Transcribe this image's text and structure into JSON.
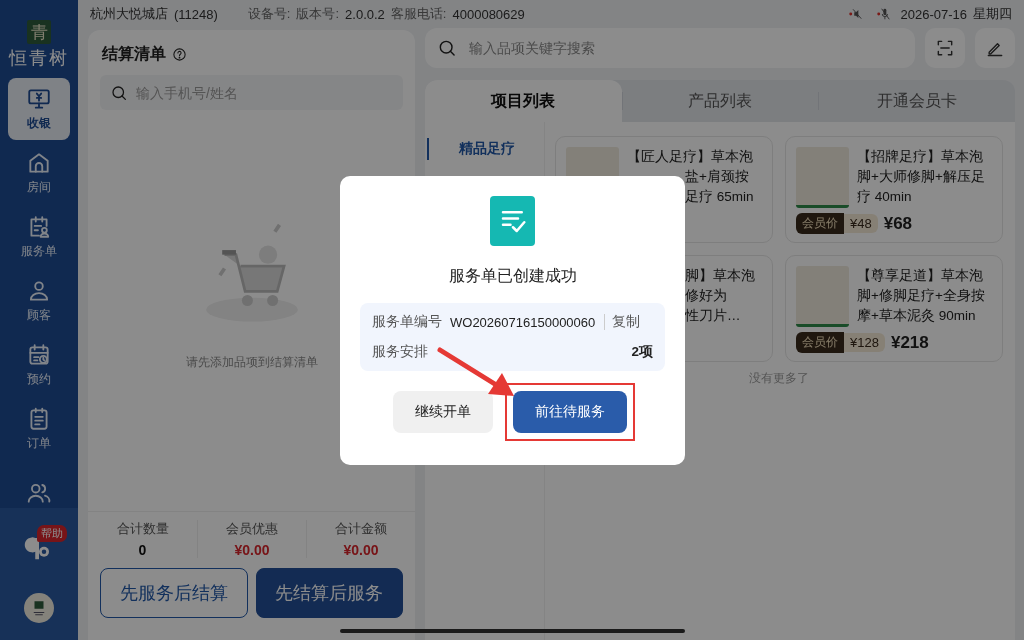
{
  "status_bar": {
    "store": "杭州大悦城店",
    "store_code": "(11248)",
    "device_label": "设备号:",
    "version_label": "版本号:",
    "version": "2.0.0.2",
    "hotline_label": "客服电话:",
    "hotline": "4000080629",
    "date": "2026-07-16",
    "weekday": "星期四"
  },
  "sidebar": {
    "logo_char": "青",
    "brand": "恒青树",
    "items": [
      {
        "label": "收银",
        "selected": true
      },
      {
        "label": "房间",
        "selected": false
      },
      {
        "label": "服务单",
        "selected": false
      },
      {
        "label": "顾客",
        "selected": false
      },
      {
        "label": "预约",
        "selected": false
      },
      {
        "label": "订单",
        "selected": false
      },
      {
        "selected": false
      }
    ],
    "help_badge": "帮助"
  },
  "checkout": {
    "title": "结算清单",
    "search": {
      "placeholder": "输入手机号/姓名"
    },
    "empty_text": "请先添加品项到结算清单",
    "totals": [
      {
        "label": "合计数量",
        "value": "0",
        "kind": "count"
      },
      {
        "label": "会员优惠",
        "value": "¥0.00",
        "kind": "money"
      },
      {
        "label": "合计金额",
        "value": "¥0.00",
        "kind": "money"
      }
    ],
    "buttons": [
      {
        "label": "先服务后结算",
        "kind": "secondary"
      },
      {
        "label": "先结算后服务",
        "kind": "primary"
      }
    ]
  },
  "catalog": {
    "search": {
      "placeholder": "输入品项关键字搜索"
    },
    "tabs": [
      {
        "label": "项目列表",
        "selected": true
      },
      {
        "label": "产品列表",
        "selected": false
      },
      {
        "label": "开通会员卡",
        "selected": false
      }
    ],
    "categories": [
      {
        "label": "精品足疗",
        "selected": true
      }
    ],
    "cards": [
      {
        "kind": "covered",
        "lines": [
          {
            "text": "【匠人足疗】草本泡",
            "clipped": false
          },
          {
            "text": "盐+肩颈按",
            "clipped": true
          },
          {
            "text": "足疗 65min",
            "clipped": true
          }
        ]
      },
      {
        "kind": "product",
        "title": "【招牌足疗】草本泡脚+大师修脚+解压足疗 40min",
        "member_label": "会员价",
        "member_price": "¥48",
        "price": "¥68"
      },
      {
        "kind": "covered",
        "lines": [
          {
            "text": "脚】草本泡",
            "clipped": true
          },
          {
            "text": "修好为",
            "clipped": true
          },
          {
            "text": "性刀片…",
            "clipped": true
          }
        ]
      },
      {
        "kind": "product",
        "title": "【尊享足道】草本泡脚+修脚足疗+全身按摩+草本泥灸 90min",
        "member_label": "会员价",
        "member_price": "¥128",
        "price": "¥218"
      }
    ],
    "end_text": "没有更多了"
  },
  "dialog": {
    "title": "服务单已创建成功",
    "rows": [
      {
        "label": "服务单编号",
        "value": "WO20260716150000060",
        "action": "复制"
      },
      {
        "label": "服务安排",
        "value": "2项"
      }
    ],
    "buttons": [
      {
        "label": "继续开单",
        "kind": "secondary",
        "highlighted": false
      },
      {
        "label": "前往待服务",
        "kind": "primary",
        "highlighted": true
      }
    ]
  }
}
